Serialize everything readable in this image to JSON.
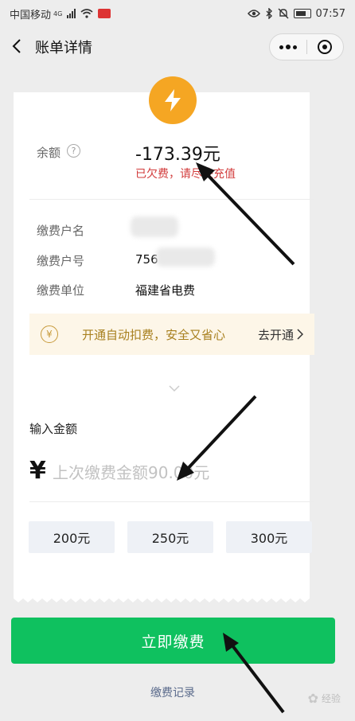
{
  "status_bar": {
    "carrier": "中国移动",
    "network_tag": "4G",
    "time": "07:57"
  },
  "nav": {
    "title": "账单详情"
  },
  "bill": {
    "balance_label": "余额",
    "balance_amount": "-173.39元",
    "warning": "已欠费，请尽快充值",
    "payer_name_label": "缴费户名",
    "payer_number_label": "缴费户号",
    "payer_number_visible": "756",
    "payee_label": "缴费单位",
    "payee_value": "福建省电费"
  },
  "autopay": {
    "text": "开通自动扣费，安全又省心",
    "link_label": "去开通"
  },
  "payment": {
    "input_title": "输入金额",
    "currency_symbol": "¥",
    "placeholder": "上次缴费金额90.00元",
    "quick_amounts": [
      "200元",
      "250元",
      "300元"
    ],
    "pay_button": "立即缴费",
    "records_link": "缴费记录"
  },
  "watermark": {
    "text": "经验"
  },
  "colors": {
    "primary_green": "#0fc15f",
    "warning_red": "#d23b3b",
    "badge_orange": "#f5a623",
    "autopay_bg": "#fdf6e8"
  }
}
